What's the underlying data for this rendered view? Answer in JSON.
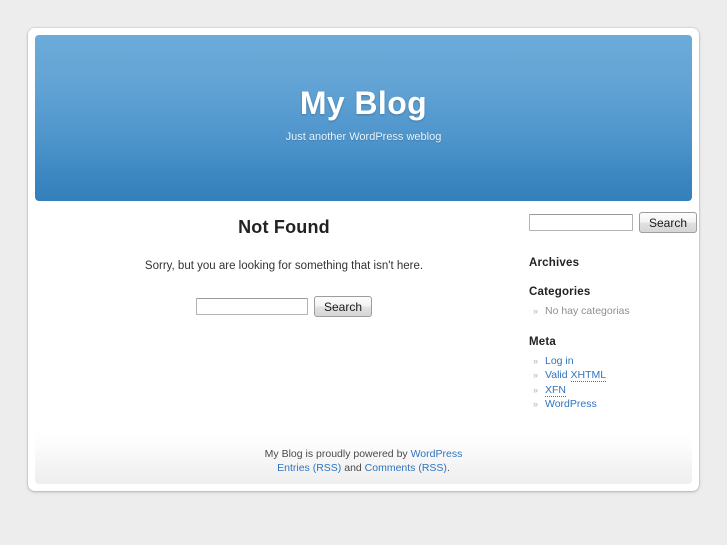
{
  "site": {
    "title": "My Blog",
    "description": "Just another WordPress weblog"
  },
  "content": {
    "heading": "Not Found",
    "message": "Sorry, but you are looking for something that isn't here.",
    "search": {
      "value": "",
      "placeholder": "",
      "button_label": "Search"
    }
  },
  "sidebar": {
    "search": {
      "value": "",
      "placeholder": "",
      "button_label": "Search"
    },
    "widgets": [
      {
        "title": "Archives",
        "items": []
      },
      {
        "title": "Categories",
        "items": [
          {
            "label": "No hay categorias",
            "is_link": false
          }
        ]
      },
      {
        "title": "Meta",
        "items": [
          {
            "label": "Log in",
            "is_link": true
          },
          {
            "label": "Valid XHTML",
            "is_link": true,
            "abbr": "XHTML"
          },
          {
            "label": "XFN",
            "is_link": true,
            "abbr": "XFN"
          },
          {
            "label": "WordPress",
            "is_link": true
          }
        ]
      }
    ]
  },
  "footer": {
    "line1_prefix": "My Blog is proudly powered by ",
    "line1_link": "WordPress",
    "line2_link1": "Entries (RSS)",
    "line2_middle": " and ",
    "line2_link2": "Comments (RSS)",
    "line2_suffix": "."
  },
  "colors": {
    "page_background": "#ededed",
    "header_gradient_top": "#6cabd9",
    "header_gradient_bottom": "#3480ba",
    "link": "#2f74c0",
    "muted_text": "#8f8f8f",
    "heading_text": "#222222"
  }
}
